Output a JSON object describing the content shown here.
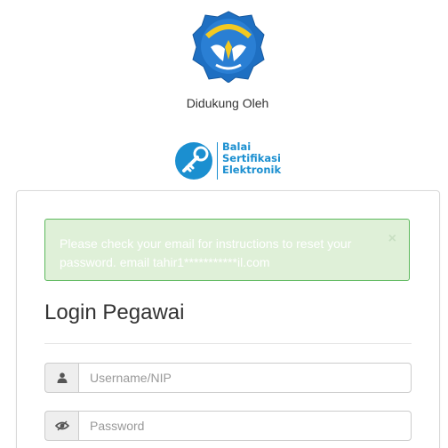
{
  "branding": {
    "supported_by": "Didukung Oleh",
    "ministry_logo_icon": "tut-wuri-handayani-logo-icon",
    "bse_logo_icon": "bse-key-logo-icon",
    "bse_name_line1": "Balai",
    "bse_name_line2": "Sertifikasi",
    "bse_name_line3": "Elektronik",
    "brand_color": "#1b8fd0"
  },
  "alert": {
    "message": "Please check your email for instructions to reset your password. email tahir1***********il.com",
    "close_label": "×",
    "background": "#dff0d8",
    "border_color": "#5cb85c"
  },
  "login": {
    "title": "Login Pegawai",
    "username_placeholder": "Username/NIP",
    "username_value": "",
    "username_icon": "user-icon",
    "password_placeholder": "Password",
    "password_value": "",
    "password_icon": "eye-icon"
  }
}
